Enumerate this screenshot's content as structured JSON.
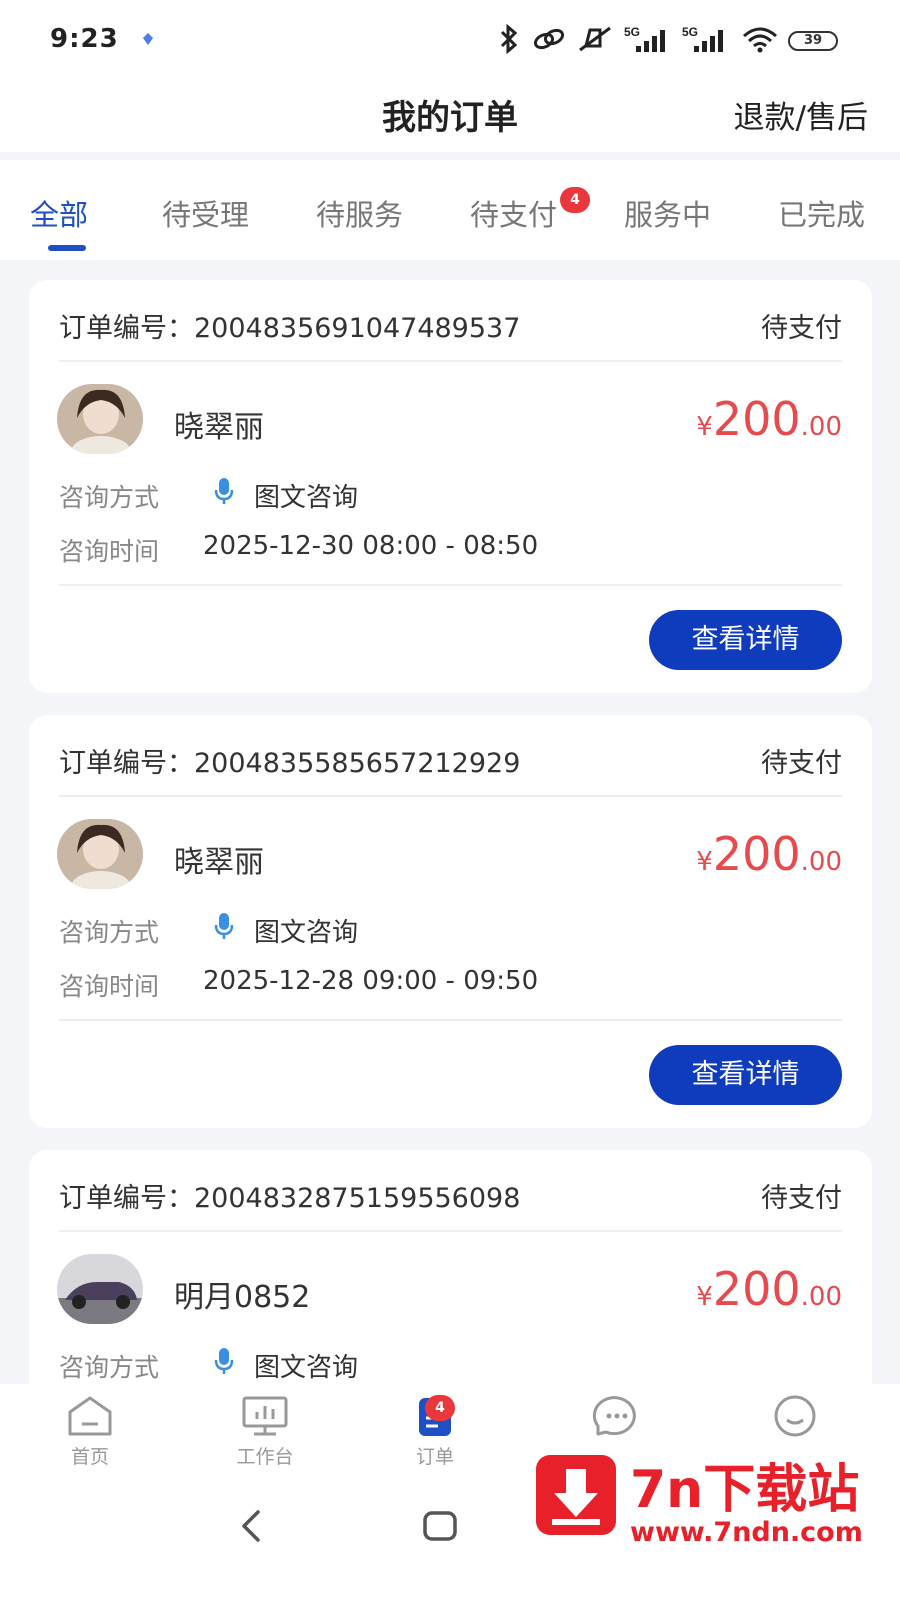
{
  "status_bar": {
    "time": "9:23",
    "battery": "39"
  },
  "header": {
    "title": "我的订单",
    "action": "退款/售后"
  },
  "tabs": [
    {
      "label": "全部",
      "active": true
    },
    {
      "label": "待受理"
    },
    {
      "label": "待服务"
    },
    {
      "label": "待支付",
      "badge": "4"
    },
    {
      "label": "服务中"
    },
    {
      "label": "已完成"
    }
  ],
  "orders": [
    {
      "order_label": "订单编号：",
      "order_no": "2004835691047489537",
      "status": "待支付",
      "name": "晓翠丽",
      "price_symbol": "¥",
      "price_int": "200",
      "price_dec": ".00",
      "method_label": "咨询方式",
      "method": "图文咨询",
      "time_label": "咨询时间",
      "time": "2025-12-30 08:00 - 08:50",
      "button": "查看详情"
    },
    {
      "order_label": "订单编号：",
      "order_no": "2004835585657212929",
      "status": "待支付",
      "name": "晓翠丽",
      "price_symbol": "¥",
      "price_int": "200",
      "price_dec": ".00",
      "method_label": "咨询方式",
      "method": "图文咨询",
      "time_label": "咨询时间",
      "time": "2025-12-28 09:00 - 09:50",
      "button": "查看详情"
    },
    {
      "order_label": "订单编号：",
      "order_no": "2004832875159556098",
      "status": "待支付",
      "name": "明月0852",
      "price_symbol": "¥",
      "price_int": "200",
      "price_dec": ".00",
      "method_label": "咨询方式",
      "method": "图文咨询"
    }
  ],
  "tabbar": [
    {
      "label": "首页",
      "icon": "home-icon"
    },
    {
      "label": "工作台",
      "icon": "workbench-icon"
    },
    {
      "label": "订单",
      "icon": "order-icon",
      "badge": "4",
      "active": true
    },
    {
      "label": "",
      "icon": "message-icon"
    },
    {
      "label": "",
      "icon": "profile-icon"
    }
  ],
  "watermark": {
    "title": "7n下载站",
    "url": "www.7ndn.com"
  },
  "colors": {
    "primary": "#1e4fc5",
    "button": "#0f3bbd",
    "price": "#e74a4d",
    "badge": "#e8383b",
    "watermark": "#e8202a"
  }
}
